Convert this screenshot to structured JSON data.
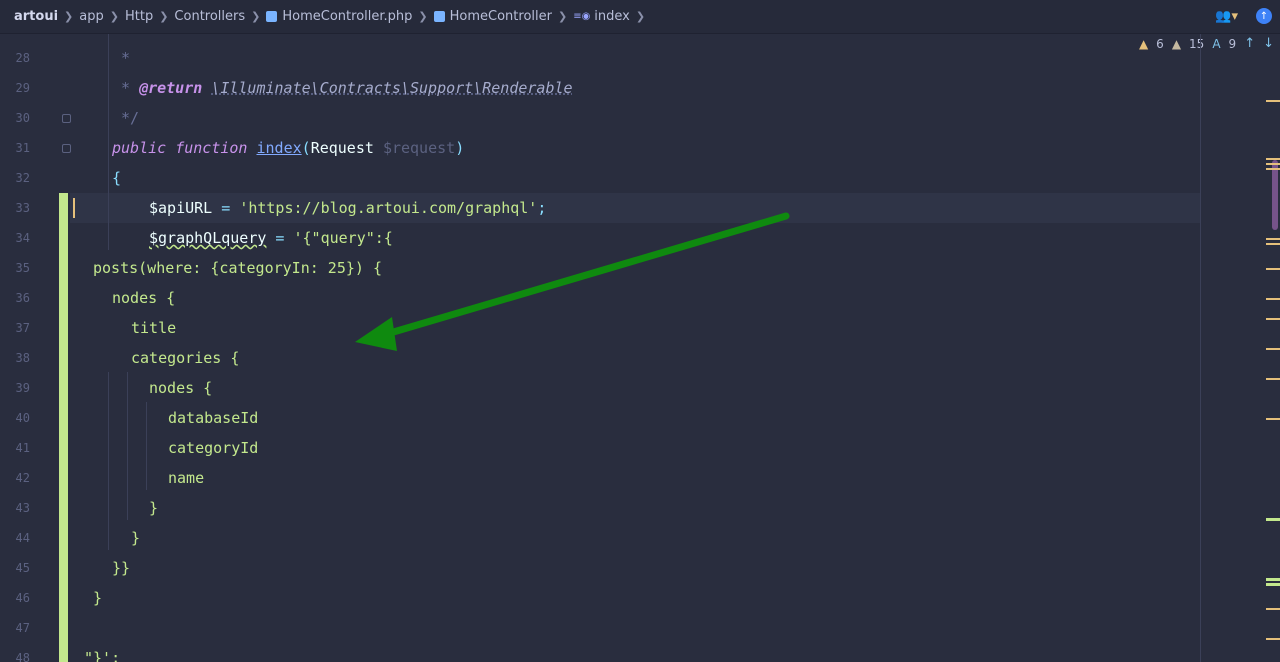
{
  "breadcrumb": {
    "root": "artoui",
    "items": [
      "app",
      "Http",
      "Controllers",
      "HomeController.php",
      "HomeController",
      "index"
    ]
  },
  "inspections": {
    "warnings": "6",
    "weak_warnings": "15",
    "typos": "9"
  },
  "line_numbers": [
    "28",
    "29",
    "30",
    "31",
    "32",
    "33",
    "34",
    "35",
    "36",
    "37",
    "38",
    "39",
    "40",
    "41",
    "42",
    "43",
    "44",
    "45",
    "46",
    "47",
    "48"
  ],
  "code": {
    "l28_star": "*",
    "l29_star": "* ",
    "l29_tag": "@return",
    "l29_type": "\\Illuminate\\Contracts\\Support\\Renderable",
    "l30_end": "*/",
    "l31_kw1": "public",
    "l31_kw2": "function",
    "l31_fn": "index",
    "l31_open": "(",
    "l31_type": "Request ",
    "l31_param": "$request",
    "l31_close": ")",
    "l32": "{",
    "l33_var": "$apiURL",
    "l33_eq": " = ",
    "l33_str": "'https://blog.artoui.com/graphql'",
    "l33_end": ";",
    "l34_var": "$graphQLquery",
    "l34_eq": " = ",
    "l34_str": "'{\"query\":{",
    "l35": "posts(where: {categoryIn: 25}) {",
    "l36": "nodes {",
    "l37": "title",
    "l38": "categories {",
    "l39": "nodes {",
    "l40": "databaseId",
    "l41": "categoryId",
    "l42": "name",
    "l43": "}",
    "l44": "}",
    "l45": "}}",
    "l46": "}",
    "l48": "\"}';"
  },
  "colors": {
    "background": "#292d3e",
    "annotation_arrow": "#0f8a0f",
    "change_bar": "#c3e88d"
  }
}
